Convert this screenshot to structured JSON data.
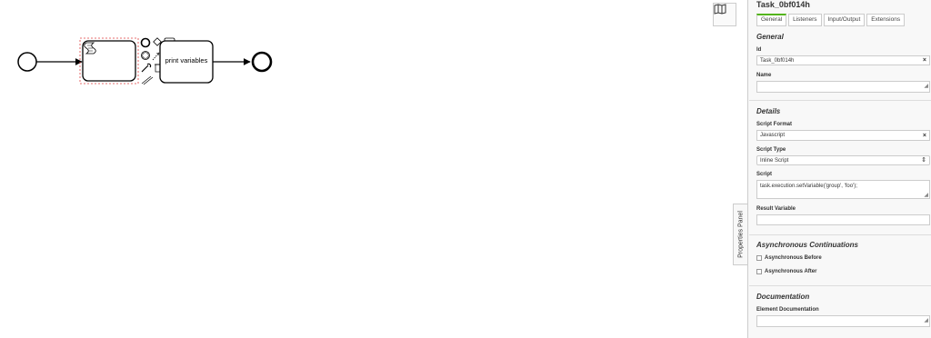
{
  "diagram": {
    "task_label": "print variables"
  },
  "icons": {
    "minimap": "map-icon",
    "script_task": "script-icon"
  },
  "toggle": {
    "label": "Properties Panel"
  },
  "panel": {
    "title": "Task_0bf014h",
    "tabs": [
      {
        "label": "General",
        "active": true
      },
      {
        "label": "Listeners",
        "active": false
      },
      {
        "label": "Input/Output",
        "active": false
      },
      {
        "label": "Extensions",
        "active": false
      }
    ],
    "general": {
      "heading": "General",
      "id_label": "Id",
      "id_value": "Task_0bf014h",
      "name_label": "Name",
      "name_value": ""
    },
    "details": {
      "heading": "Details",
      "format_label": "Script Format",
      "format_value": "Javascript",
      "type_label": "Script Type",
      "type_value": "Inline Script",
      "script_label": "Script",
      "script_value": "task.execution.setVariable('group', 'foo');",
      "result_label": "Result Variable",
      "result_value": ""
    },
    "async": {
      "heading": "Asynchronous Continuations",
      "before_label": "Asynchronous Before",
      "after_label": "Asynchronous After"
    },
    "documentation": {
      "heading": "Documentation",
      "element_label": "Element Documentation",
      "element_value": ""
    },
    "clear_symbol": "×",
    "select_symbol": "⇕",
    "resize_symbol": "◢"
  },
  "colors": {
    "accent": "#52b415",
    "selection": "#e04040"
  }
}
